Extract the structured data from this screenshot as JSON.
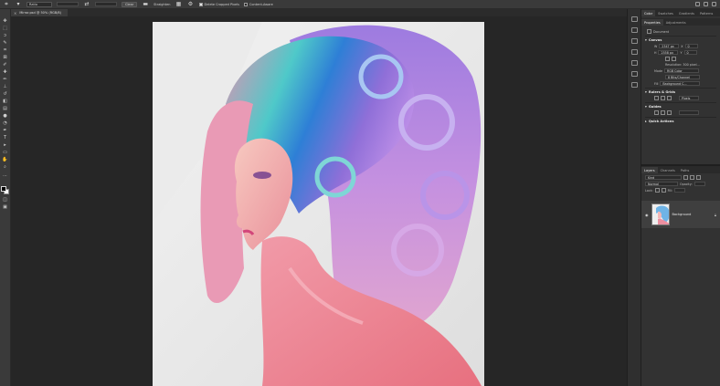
{
  "options_bar": {
    "ratio_label": "Ratio",
    "clear_label": "Clear",
    "straighten_label": "Straighten",
    "delete_cropped_label": "Delete Cropped Pixels",
    "content_aware_label": "Content-Aware"
  },
  "document_tab": {
    "title": "Mirror.psd @ 50% (RGB/8)",
    "close": "×"
  },
  "right_panel": {
    "top_tabs": [
      "Color",
      "Swatches",
      "Gradients",
      "Patterns"
    ],
    "prop_tabs": [
      "Properties",
      "Adjustments"
    ],
    "document_label": "Document",
    "canvas": {
      "header": "Canvas",
      "width_label": "W",
      "width_value": "2347 px",
      "height_label": "H",
      "height_value": "2558 px",
      "x_label": "X",
      "y_label": "Y",
      "x_value": "0",
      "y_value": "0",
      "resolution": "Resolution: 300 pixel...",
      "mode_label": "Mode",
      "mode_value": "RGB Color",
      "bits_value": "8 Bits/Channel",
      "fill_label": "Fill",
      "fill_value": "Background C..."
    },
    "rulers_header": "Rulers & Grids",
    "rulers_unit": "Pixels",
    "guides_header": "Guides",
    "quick_actions_header": "Quick Actions"
  },
  "layers_panel": {
    "tabs": [
      "Layers",
      "Channels",
      "Paths"
    ],
    "search_placeholder": "Kind",
    "blend_mode": "Normal",
    "opacity_label": "Opacity:",
    "lock_label": "Lock:",
    "fill_label": "Fill:",
    "layer_name": "Background"
  },
  "colors": {
    "app_bg": "#232323",
    "panel": "#323232",
    "toolbar": "#3a3a3a"
  }
}
